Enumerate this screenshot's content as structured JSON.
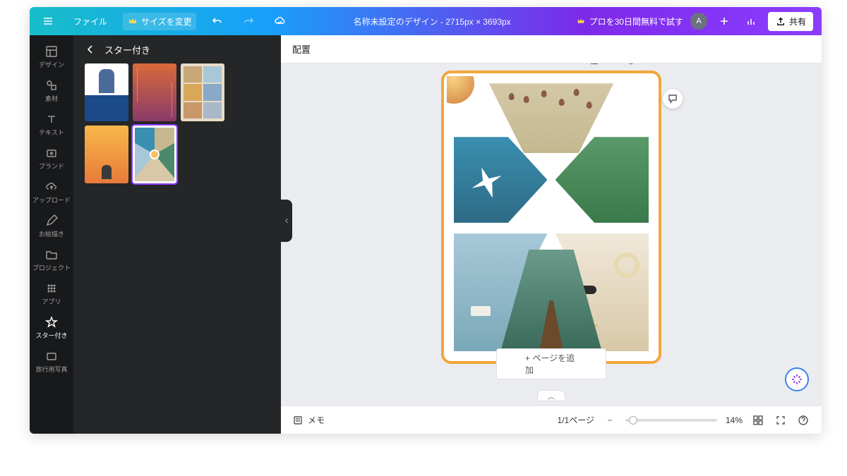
{
  "topbar": {
    "file": "ファイル",
    "resize": "サイズを変更",
    "doc_title": "名称未設定のデザイン - 2715px × 3693px",
    "pro": "プロを30日間無料で試す",
    "avatar": "A",
    "share": "共有"
  },
  "sidenav": [
    {
      "id": "design",
      "label": "デザイン"
    },
    {
      "id": "elements",
      "label": "素材"
    },
    {
      "id": "text",
      "label": "テキスト"
    },
    {
      "id": "brand",
      "label": "ブランド"
    },
    {
      "id": "upload",
      "label": "アップロード"
    },
    {
      "id": "draw",
      "label": "お絵描き"
    },
    {
      "id": "projects",
      "label": "プロジェクト"
    },
    {
      "id": "apps",
      "label": "アプリ"
    },
    {
      "id": "starred",
      "label": "スター付き",
      "active": true
    },
    {
      "id": "travel",
      "label": "旅行用写真"
    }
  ],
  "panel": {
    "title": "スター付き"
  },
  "optbar": {
    "label": "配置"
  },
  "canvas": {
    "add_page": "+ ページを追加"
  },
  "bottombar": {
    "notes": "メモ",
    "page_indicator": "1/1ページ",
    "zoom": "14%"
  }
}
